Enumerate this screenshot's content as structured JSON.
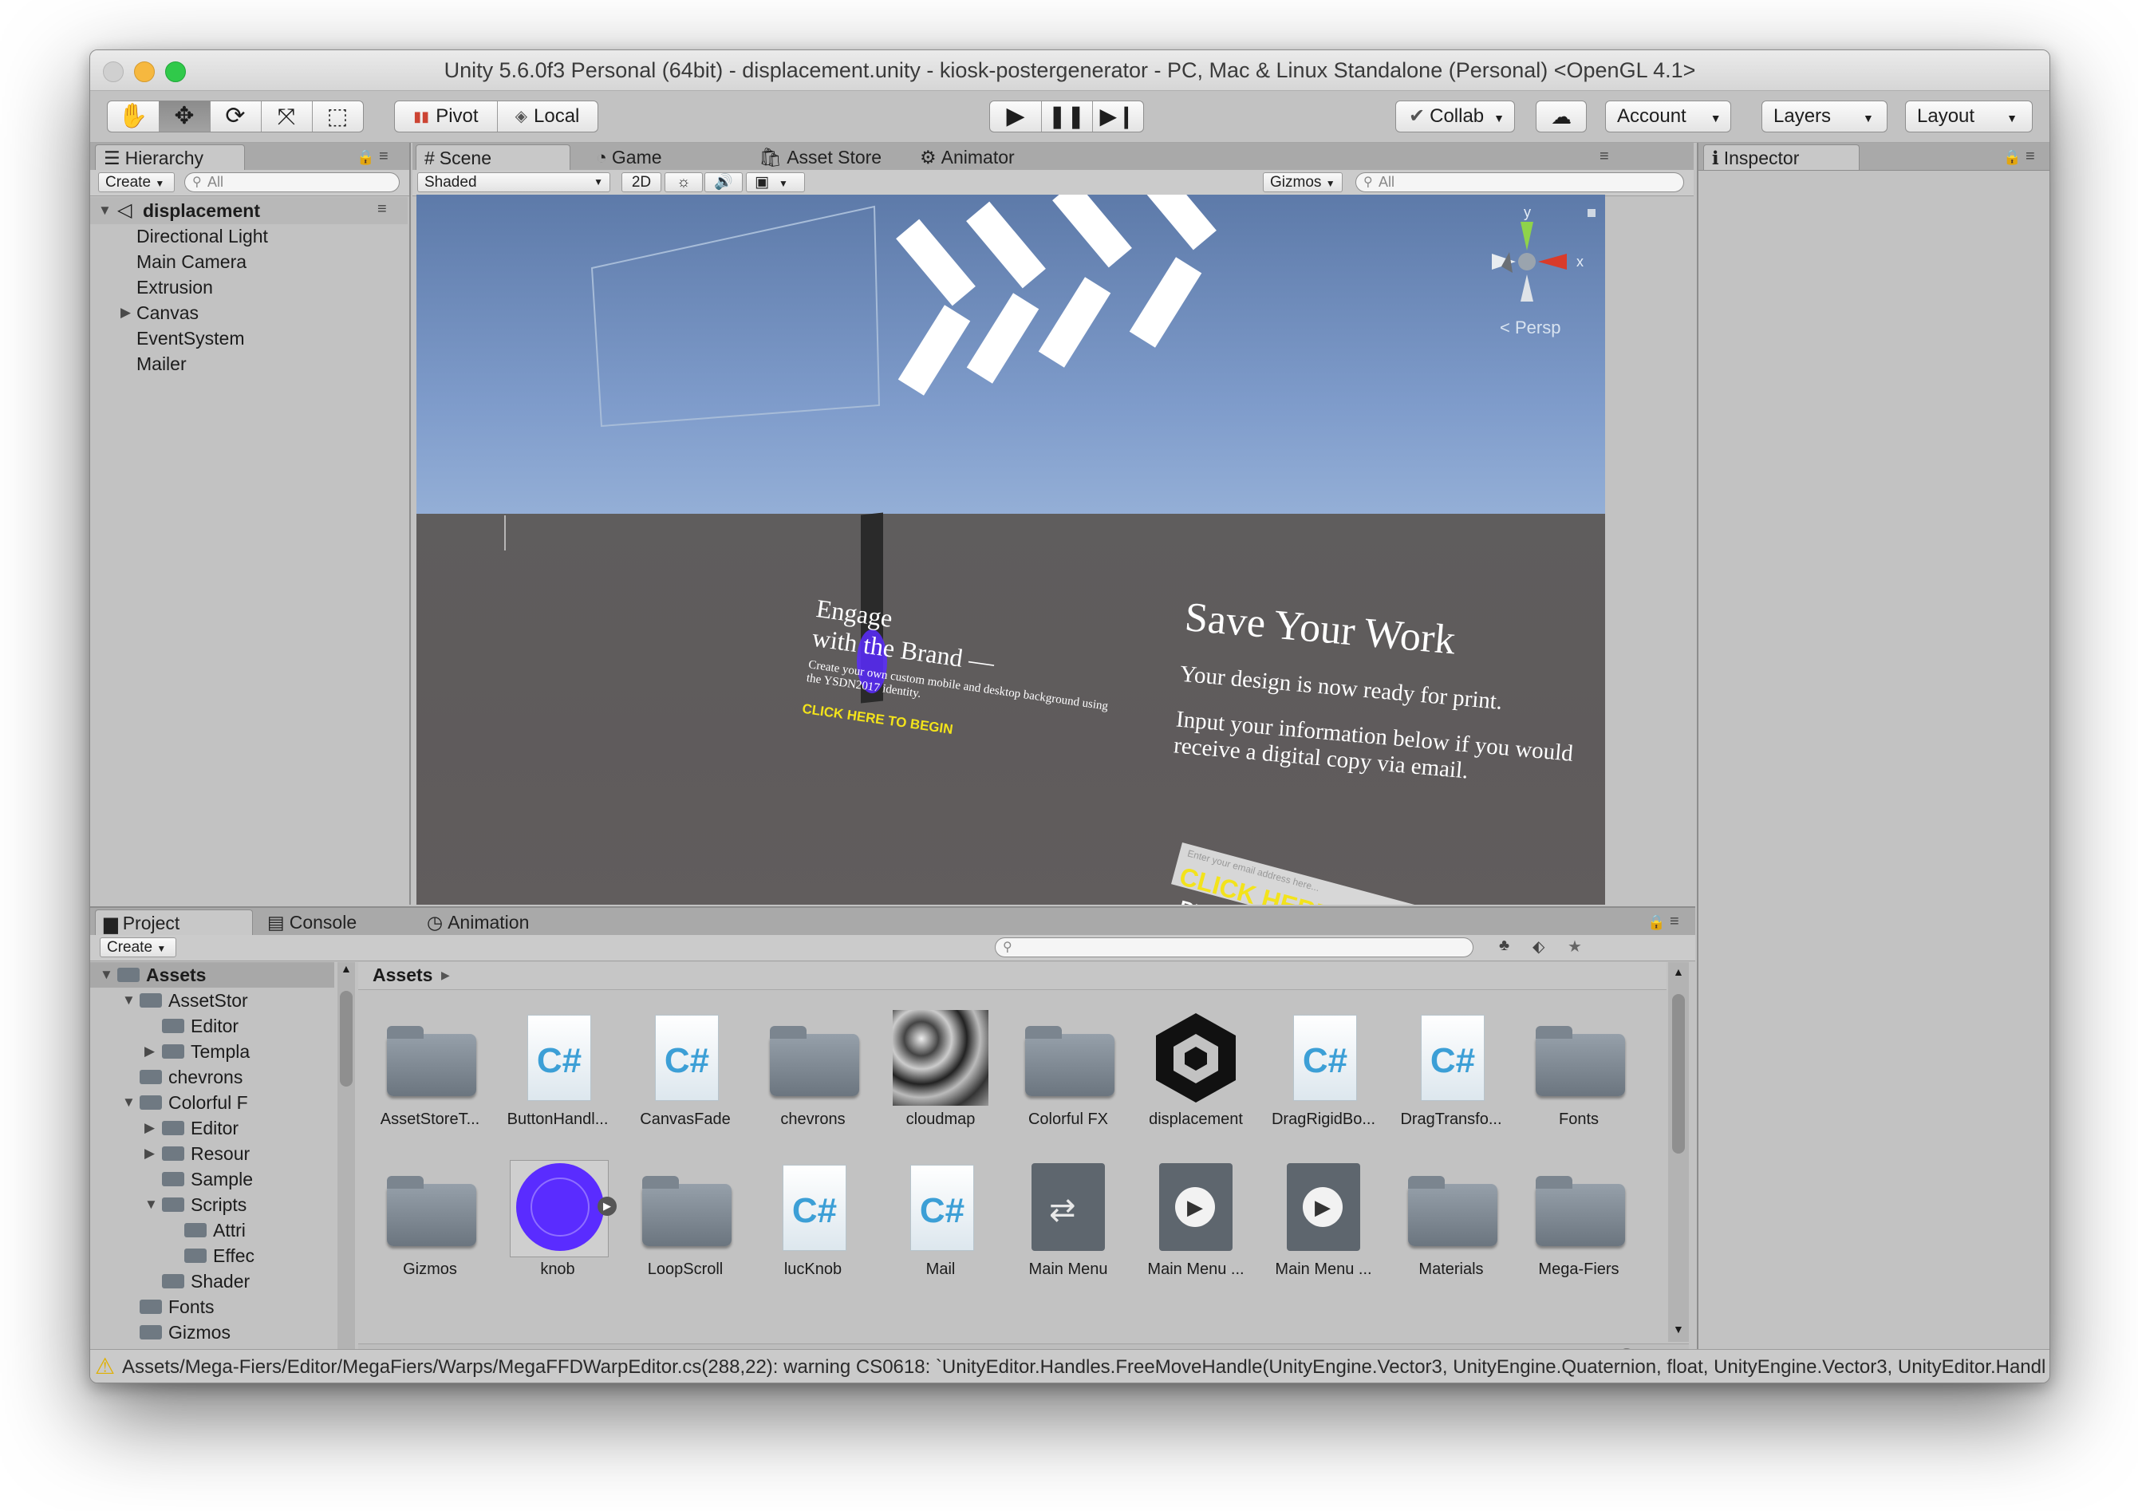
{
  "window": {
    "title": "Unity 5.6.0f3 Personal (64bit) - displacement.unity - kiosk-postergenerator - PC, Mac & Linux Standalone (Personal) <OpenGL 4.1>"
  },
  "toolbar": {
    "pivot": "Pivot",
    "local": "Local",
    "collab": "Collab",
    "account": "Account",
    "layers": "Layers",
    "layout": "Layout"
  },
  "hierarchy": {
    "tab": "Hierarchy",
    "create": "Create",
    "search_placeholder": "All",
    "scene": "displacement",
    "items": [
      "Directional Light",
      "Main Camera",
      "Extrusion",
      "Canvas",
      "EventSystem",
      "Mailer"
    ]
  },
  "scene_view": {
    "tabs": [
      "Scene",
      "Game",
      "Asset Store",
      "Animator"
    ],
    "shading": "Shaded",
    "mode_2d": "2D",
    "gizmos": "Gizmos",
    "search_placeholder": "All",
    "gizmo_y": "y",
    "gizmo_x": "x",
    "persp": "Persp",
    "engage_title_1": "Engage",
    "engage_title_2": "with the Brand —",
    "engage_desc_1": "Create your own custom mobile and desktop background using",
    "engage_desc_2": "the YSDN2017 identity.",
    "engage_cta": "CLICK HERE TO BEGIN",
    "save_title": "Save Your Work",
    "save_line1": "Your design is now ready for print.",
    "save_line2": "Input your information below if you would",
    "save_line3": "receive a digital copy via email.",
    "email_placeholder": "Enter your email address here...",
    "send_cta": "CLICK HERE TO SEND",
    "return_cta": "RETURN TO MAIN MENU"
  },
  "inspector": {
    "tab": "Inspector"
  },
  "project": {
    "tabs": [
      "Project",
      "Console",
      "Animation"
    ],
    "create": "Create",
    "breadcrumb": "Assets",
    "tree": [
      {
        "label": "Assets",
        "level": 0,
        "arrow": "open"
      },
      {
        "label": "AssetStor",
        "level": 1,
        "arrow": "open"
      },
      {
        "label": "Editor",
        "level": 2,
        "arrow": ""
      },
      {
        "label": "Templa",
        "level": 2,
        "arrow": "closed"
      },
      {
        "label": "chevrons",
        "level": 1,
        "arrow": ""
      },
      {
        "label": "Colorful F",
        "level": 1,
        "arrow": "open"
      },
      {
        "label": "Editor",
        "level": 2,
        "arrow": "closed"
      },
      {
        "label": "Resour",
        "level": 2,
        "arrow": "closed"
      },
      {
        "label": "Sample",
        "level": 2,
        "arrow": ""
      },
      {
        "label": "Scripts",
        "level": 2,
        "arrow": "open"
      },
      {
        "label": "Attri",
        "level": 3,
        "arrow": ""
      },
      {
        "label": "Effec",
        "level": 3,
        "arrow": ""
      },
      {
        "label": "Shader",
        "level": 2,
        "arrow": ""
      },
      {
        "label": "Fonts",
        "level": 1,
        "arrow": ""
      },
      {
        "label": "Gizmos",
        "level": 1,
        "arrow": ""
      }
    ],
    "assets": [
      {
        "label": "AssetStoreT...",
        "kind": "folder"
      },
      {
        "label": "ButtonHandl...",
        "kind": "script"
      },
      {
        "label": "CanvasFade",
        "kind": "script"
      },
      {
        "label": "chevrons",
        "kind": "folder"
      },
      {
        "label": "cloudmap",
        "kind": "texture"
      },
      {
        "label": "Colorful FX",
        "kind": "folder"
      },
      {
        "label": "displacement",
        "kind": "unity"
      },
      {
        "label": "DragRigidBo...",
        "kind": "script"
      },
      {
        "label": "DragTransfo...",
        "kind": "script"
      },
      {
        "label": "Fonts",
        "kind": "folder"
      },
      {
        "label": "Gizmos",
        "kind": "folder"
      },
      {
        "label": "knob",
        "kind": "knob"
      },
      {
        "label": "LoopScroll",
        "kind": "folder"
      },
      {
        "label": "lucKnob",
        "kind": "script"
      },
      {
        "label": "Mail",
        "kind": "script"
      },
      {
        "label": "Main Menu",
        "kind": "animator"
      },
      {
        "label": "Main Menu ...",
        "kind": "anim"
      },
      {
        "label": "Main Menu ...",
        "kind": "anim"
      },
      {
        "label": "Materials",
        "kind": "folder"
      },
      {
        "label": "Mega-Fiers",
        "kind": "folder"
      }
    ]
  },
  "status": {
    "message": "Assets/Mega-Fiers/Editor/MegaFiers/Warps/MegaFFDWarpEditor.cs(288,22): warning CS0618: `UnityEditor.Handles.FreeMoveHandle(UnityEngine.Vector3, UnityEngine.Quaternion, float, UnityEngine.Vector3, UnityEditor.Handl"
  },
  "colors": {
    "accent_yellow": "#f3e31b",
    "knob_purple": "#5a2cff",
    "panel_gray": "#c2c2c2"
  }
}
